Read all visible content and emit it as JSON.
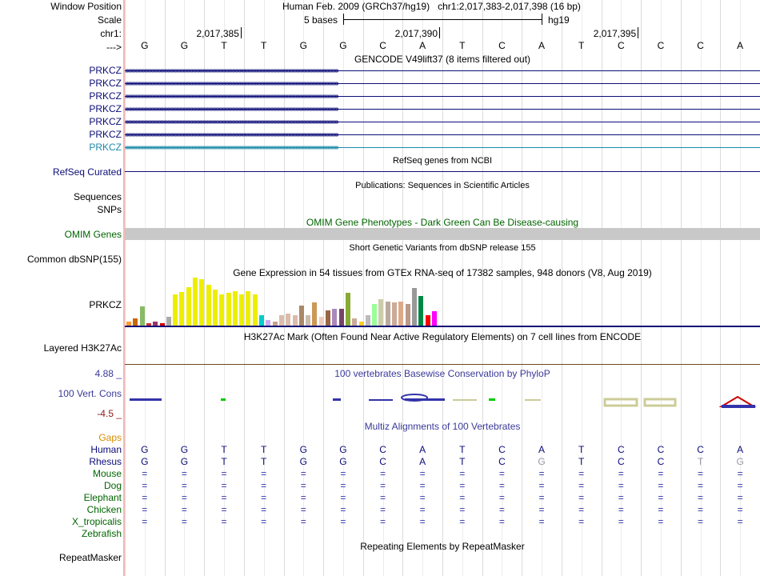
{
  "header": {
    "window_position_label": "Window Position",
    "scale_label": "Scale",
    "chrom_label": "chr1:",
    "strand_label": "--->",
    "assembly": "Human Feb. 2009 (GRCh37/hg19)",
    "position": "chr1:2,017,383-2,017,398 (16 bp)",
    "scale_text": "5 bases",
    "scale_db": "hg19",
    "ticks": [
      {
        "label": "2,017,385",
        "base_index": 2
      },
      {
        "label": "2,017,390",
        "base_index": 7
      },
      {
        "label": "2,017,395",
        "base_index": 12
      }
    ]
  },
  "sequence": [
    "G",
    "G",
    "T",
    "T",
    "G",
    "G",
    "C",
    "A",
    "T",
    "C",
    "A",
    "T",
    "C",
    "C",
    "C",
    "A"
  ],
  "gencode": {
    "title": "GENCODE V49lift37 (8 items filtered out)",
    "items": [
      "PRKCZ",
      "PRKCZ",
      "PRKCZ",
      "PRKCZ",
      "PRKCZ",
      "PRKCZ",
      "PRKCZ"
    ],
    "colors": [
      "#0c0c78",
      "#0c0c78",
      "#0c0c78",
      "#0c0c78",
      "#0c0c78",
      "#0c0c78",
      "#1d8aa8"
    ]
  },
  "refseq": {
    "title": "RefSeq genes from NCBI",
    "label": "RefSeq Curated"
  },
  "publications": {
    "title": "Publications: Sequences in Scientific Articles",
    "label1": "Sequences",
    "label2": "SNPs"
  },
  "omim": {
    "title": "OMIM Gene Phenotypes - Dark Green Can Be Disease-causing",
    "label": "OMIM Genes",
    "color": "#006400"
  },
  "dbsnp": {
    "title": "Short Genetic Variants from dbSNP release 155",
    "label": "Common dbSNP(155)"
  },
  "gtex": {
    "title": "Gene Expression in 54 tissues from GTEx RNA-seq of 17382 samples, 948 donors (V8, Aug 2019)",
    "label": "PRKCZ",
    "values": [
      0.08,
      0.15,
      0.4,
      0.05,
      0.08,
      0.05,
      0.18,
      0.65,
      0.7,
      0.8,
      1.0,
      0.96,
      0.85,
      0.75,
      0.65,
      0.68,
      0.72,
      0.65,
      0.72,
      0.65,
      0.22,
      0.12,
      0.08,
      0.22,
      0.25,
      0.22,
      0.42,
      0.22,
      0.48,
      0.18,
      0.32,
      0.35,
      0.35,
      0.68,
      0.15,
      0.08,
      0.22,
      0.45,
      0.55,
      0.5,
      0.48,
      0.5,
      0.45,
      0.78,
      0.62,
      0.22,
      0.3
    ],
    "colors": [
      "#ff9933",
      "#cc6600",
      "#88bb66",
      "#cc3333",
      "#993366",
      "#cc0000",
      "#aaaaaa",
      "#eeee00",
      "#eeee00",
      "#eeee00",
      "#eeee00",
      "#eeee00",
      "#eeee00",
      "#eeee00",
      "#eeee00",
      "#eeee00",
      "#eeee00",
      "#eeee00",
      "#eeee00",
      "#eeee00",
      "#00cccc",
      "#ccaaee",
      "#cca088",
      "#ddbbaa",
      "#ddbbaa",
      "#ddbbaa",
      "#aa8866",
      "#ccbbaa",
      "#cc9955",
      "#eeccbb",
      "#996644",
      "#aa88bb",
      "#774466",
      "#88aa33",
      "#ccaa99",
      "#ffcc22",
      "#bbbbbb",
      "#99ff99",
      "#ccccaa",
      "#bbaa99",
      "#ccaa99",
      "#ddaa88",
      "#bb9988",
      "#999999",
      "#008844",
      "#ff0000",
      "#ff00ff"
    ]
  },
  "h3k27": {
    "title": "H3K27Ac Mark (Often Found Near Active Regulatory Elements) on 7 cell lines from ENCODE",
    "label": "Layered H3K27Ac"
  },
  "phylop": {
    "title": "100 vertebrates Basewise Conservation by PhyloP",
    "label": "100 Vert. Cons",
    "max": "4.88 _",
    "min": "-4.5 _"
  },
  "multiz": {
    "title": "Multiz Alignments of 100 Vertebrates",
    "gaps_label": "Gaps",
    "species": [
      {
        "name": "Human",
        "color": "#0c0c78",
        "row": "GGTTGGCATCATCCCA"
      },
      {
        "name": "Rhesus",
        "color": "#0c0c78",
        "row": "GGTTGGCATCGTCCTG"
      },
      {
        "name": "Mouse",
        "color": "#006400",
        "row": "================"
      },
      {
        "name": "Dog",
        "color": "#006400",
        "row": "================"
      },
      {
        "name": "Elephant",
        "color": "#006400",
        "row": "================"
      },
      {
        "name": "Chicken",
        "color": "#006400",
        "row": "================"
      },
      {
        "name": "X_tropicalis",
        "color": "#006400",
        "row": "================"
      },
      {
        "name": "Zebrafish",
        "color": "#006400",
        "row": ""
      }
    ]
  },
  "repeatmasker": {
    "title": "Repeating Elements by RepeatMasker",
    "label": "RepeatMasker"
  }
}
